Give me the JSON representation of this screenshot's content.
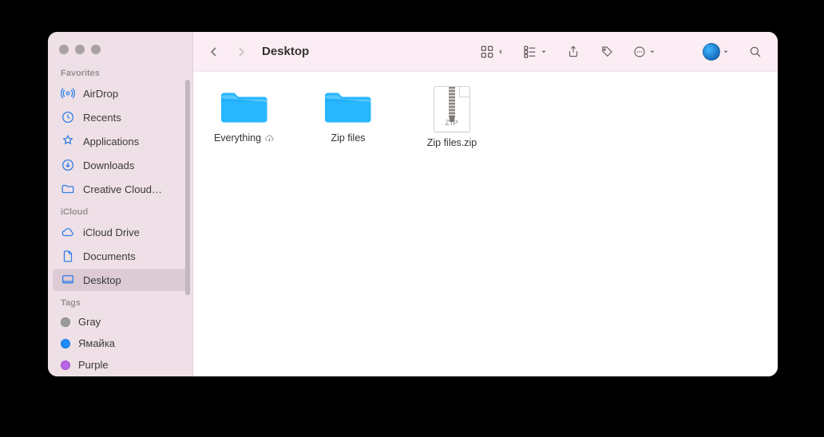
{
  "window": {
    "title": "Desktop"
  },
  "sidebar": {
    "sections": [
      {
        "title": "Favorites",
        "items": [
          {
            "icon": "airdrop",
            "label": "AirDrop"
          },
          {
            "icon": "clock",
            "label": "Recents"
          },
          {
            "icon": "apps",
            "label": "Applications"
          },
          {
            "icon": "download",
            "label": "Downloads"
          },
          {
            "icon": "ccfolder",
            "label": "Creative Cloud…"
          }
        ]
      },
      {
        "title": "iCloud",
        "items": [
          {
            "icon": "cloud",
            "label": "iCloud Drive"
          },
          {
            "icon": "doc",
            "label": "Documents"
          },
          {
            "icon": "desktop",
            "label": "Desktop",
            "selected": true
          }
        ]
      },
      {
        "title": "Tags",
        "items": [
          {
            "icon": "tag",
            "color": "#9a9a9a",
            "label": "Gray"
          },
          {
            "icon": "tag",
            "color": "#1f8bff",
            "label": "Ямайка"
          },
          {
            "icon": "tag",
            "color": "#b765e8",
            "label": "Purple"
          }
        ]
      }
    ]
  },
  "toolbar": {
    "back": "‹",
    "forward": "›"
  },
  "items": [
    {
      "type": "folder",
      "label": "Everything",
      "cloud": true
    },
    {
      "type": "folder",
      "label": "Zip files",
      "cloud": false
    },
    {
      "type": "zip",
      "label": "Zip files.zip",
      "badge": "ZIP"
    }
  ]
}
